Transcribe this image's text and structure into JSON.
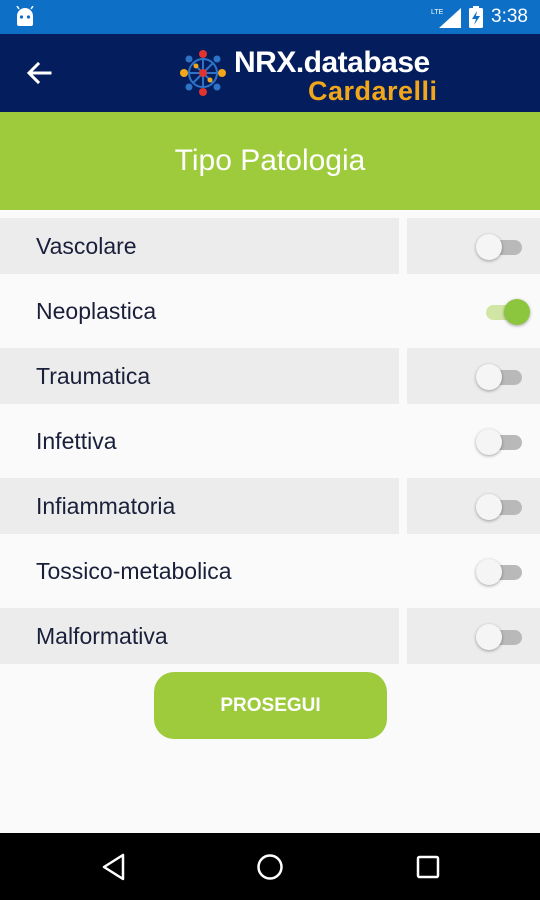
{
  "status_bar": {
    "time": "3:38",
    "network": "LTE",
    "icons": [
      "android-debug-icon",
      "lte-signal-icon",
      "battery-charging-icon"
    ]
  },
  "app_bar": {
    "logo_title": "NRX.database",
    "logo_subtitle": "Cardarelli",
    "back_icon": "arrow-left-icon",
    "colors": {
      "background": "#041e5d",
      "subtitle": "#f2a71b"
    }
  },
  "section": {
    "title": "Tipo Patologia",
    "color": "#9ecb3c"
  },
  "pathologies": [
    {
      "label": "Vascolare",
      "checked": false
    },
    {
      "label": "Neoplastica",
      "checked": true
    },
    {
      "label": "Traumatica",
      "checked": false
    },
    {
      "label": "Infettiva",
      "checked": false
    },
    {
      "label": "Infiammatoria",
      "checked": false
    },
    {
      "label": "Tossico-metabolica",
      "checked": false
    },
    {
      "label": "Malformativa",
      "checked": false
    }
  ],
  "actions": {
    "proceed_label": "PROSEGUI"
  },
  "nav_bar": {
    "buttons": [
      "back-triangle-icon",
      "home-circle-icon",
      "recents-square-icon"
    ]
  }
}
